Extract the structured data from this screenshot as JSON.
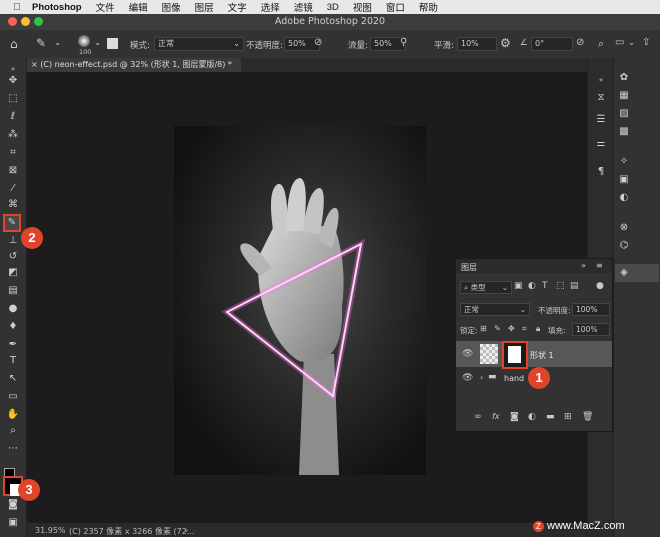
{
  "menubar": {
    "app": "Photoshop",
    "items": [
      "文件",
      "编辑",
      "图像",
      "图层",
      "文字",
      "选择",
      "滤镜",
      "3D",
      "视图",
      "窗口",
      "帮助"
    ]
  },
  "window": {
    "title": "Adobe Photoshop 2020"
  },
  "options": {
    "brush_size": "100",
    "mode_label": "模式:",
    "mode_value": "正常",
    "opacity_label": "不透明度:",
    "opacity_value": "50%",
    "flow_label": "流量:",
    "flow_value": "50%",
    "smooth_label": "平滑:",
    "smooth_value": "10%",
    "angle_value": "0°"
  },
  "document": {
    "tab_title": "(C) neon-effect.psd @ 32% (形状 1, 图层蒙版/8) *",
    "zoom": "31.95%",
    "info": "(C) 2357 像素 x 3266 像素 (72..."
  },
  "layers": {
    "panel_title": "图层",
    "filter_kind": "类型",
    "blend_mode": "正常",
    "opacity_label": "不透明度:",
    "opacity_value": "100%",
    "lock_label": "锁定:",
    "fill_label": "填充:",
    "fill_value": "100%",
    "items": [
      {
        "name": "形状 1",
        "selected": true
      },
      {
        "name": "hand",
        "selected": false
      }
    ]
  },
  "annotations": [
    "1",
    "2",
    "3"
  ],
  "watermark": "www.MacZ.com",
  "colors": {
    "accent_badge": "#e0452c",
    "neon_stroke": "#ff6ee8",
    "highlight_border": "#e0452c"
  }
}
